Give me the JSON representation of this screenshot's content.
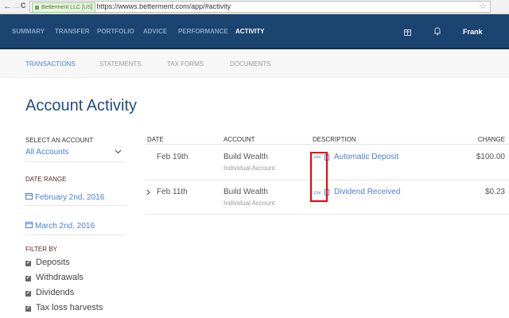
{
  "browser": {
    "back": "←",
    "forward": "→",
    "reload": "C",
    "secure_label": "Betterment LLC [US]",
    "url": "https://wwws.betterment.com/app/#activity",
    "star": "☆"
  },
  "topnav": {
    "items": [
      "SUMMARY",
      "TRANSFER",
      "PORTFOLIO",
      "ADVICE",
      "PERFORMANCE",
      "ACTIVITY"
    ],
    "active": "ACTIVITY",
    "user": "Frank",
    "icons": [
      "gift-icon",
      "bell-icon"
    ]
  },
  "subnav": {
    "items": [
      "TRANSACTIONS",
      "STATEMENTS",
      "TAX FORMS",
      "DOCUMENTS"
    ],
    "active": "TRANSACTIONS"
  },
  "page_title": "Account Activity",
  "sidebar": {
    "account_label": "SELECT AN ACCOUNT",
    "account_value": "All Accounts",
    "date_label": "DATE RANGE",
    "date_start": "February 2nd, 2016",
    "date_end": "March 2nd, 2016",
    "filter_label": "FILTER BY",
    "filters": [
      {
        "label": "Deposits",
        "checked": true
      },
      {
        "label": "Withdrawals",
        "checked": true
      },
      {
        "label": "Dividends",
        "checked": true
      },
      {
        "label": "Tax loss harvests",
        "checked": true
      }
    ]
  },
  "table": {
    "headers": [
      "DATE",
      "ACCOUNT",
      "DESCRIPTION",
      "CHANGE"
    ],
    "rows": [
      {
        "date": "Feb 19th",
        "account": "Build Wealth",
        "account_type": "Individual Account",
        "csv": ".csv",
        "description": "Automatic Deposit",
        "change": "$100.00",
        "expandable": false
      },
      {
        "date": "Feb 11th",
        "account": "Build Wealth",
        "account_type": "Individual Account",
        "csv": ".csv",
        "description": "Dividend Received",
        "change": "$0.23",
        "expandable": true
      }
    ]
  },
  "colors": {
    "nav_bg": "#1b4470",
    "accent": "#4a80d6",
    "highlight_box": "#e00000"
  }
}
